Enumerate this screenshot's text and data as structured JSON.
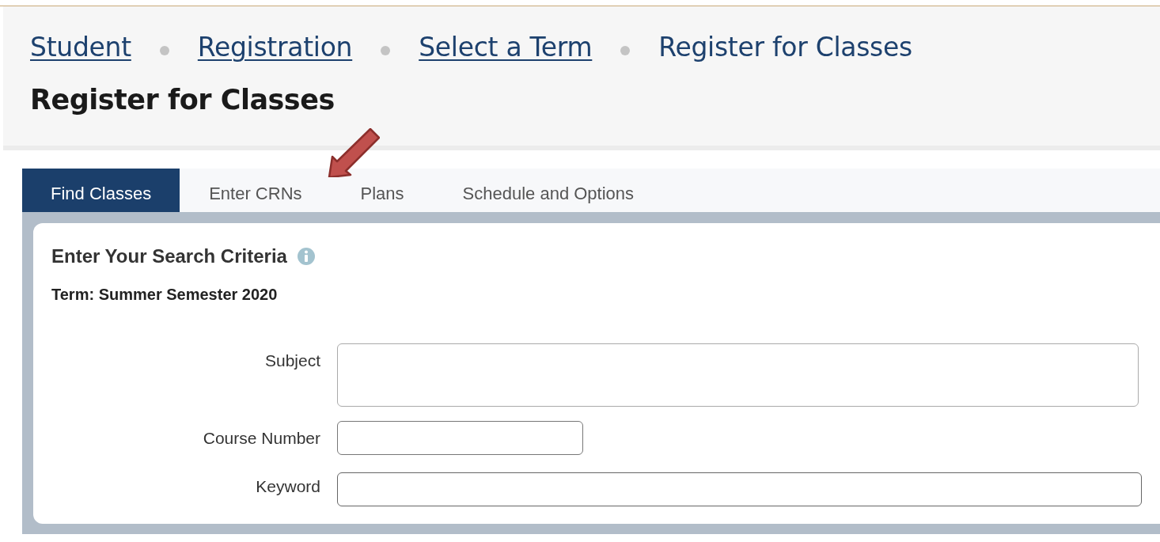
{
  "breadcrumbs": [
    {
      "label": "Student",
      "link": true
    },
    {
      "label": "Registration",
      "link": true
    },
    {
      "label": "Select a Term",
      "link": true
    },
    {
      "label": "Register for Classes",
      "link": false
    }
  ],
  "page_title": "Register for Classes",
  "tabs": [
    {
      "label": "Find Classes",
      "selected": true
    },
    {
      "label": "Enter CRNs",
      "selected": false
    },
    {
      "label": "Plans",
      "selected": false
    },
    {
      "label": "Schedule and Options",
      "selected": false
    }
  ],
  "panel": {
    "heading": "Enter Your Search Criteria",
    "term": "Term: Summer Semester 2020",
    "fields": [
      {
        "label": "Subject",
        "kind": "multiselect"
      },
      {
        "label": "Course Number",
        "kind": "short"
      },
      {
        "label": "Keyword",
        "kind": "text"
      }
    ]
  }
}
